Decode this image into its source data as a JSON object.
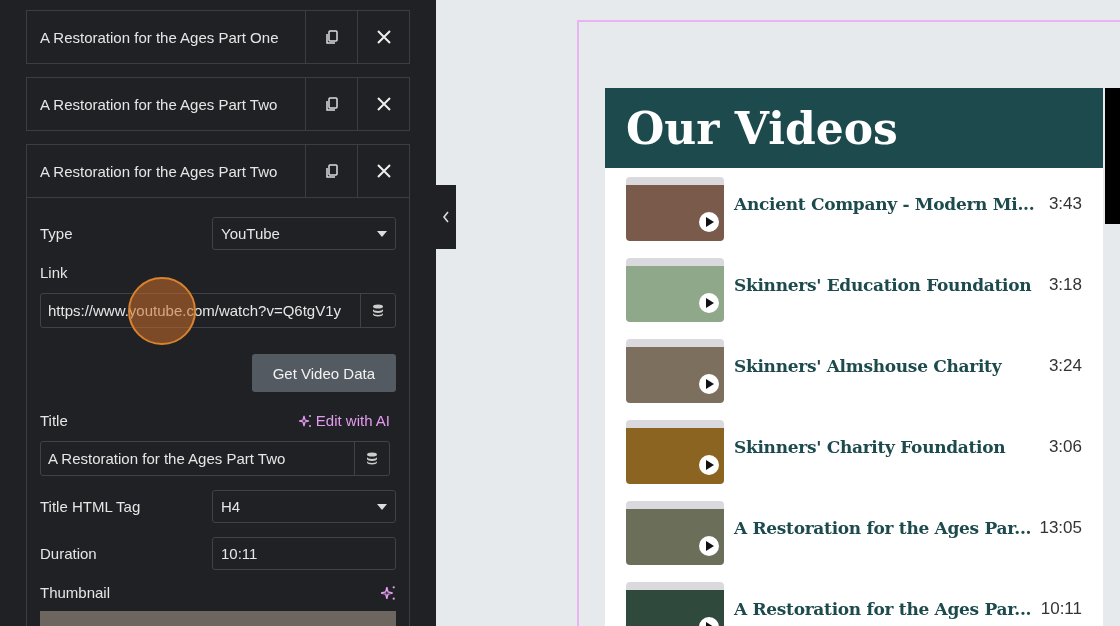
{
  "editor": {
    "items": [
      {
        "title": "A Restoration for the Ages Part One",
        "expanded": false
      },
      {
        "title": "A Restoration for the Ages Part Two",
        "expanded": false
      },
      {
        "title": "A Restoration for the Ages Part Two",
        "expanded": true
      }
    ],
    "fields": [
      {
        "kind": "select",
        "label": "Type",
        "value": "YouTube"
      },
      {
        "kind": "dynamic",
        "label": "Link",
        "value": "https://www.youtube.com/watch?v=Q6tgV1y"
      },
      {
        "kind": "button",
        "label": "Get Video Data"
      },
      {
        "kind": "dynamic",
        "label": "Title",
        "action": "Edit with AI",
        "value": "A Restoration for the Ages Part Two"
      },
      {
        "kind": "select",
        "label": "Title HTML Tag",
        "value": "H4"
      },
      {
        "kind": "text",
        "label": "Duration",
        "value": "10:11"
      },
      {
        "kind": "image",
        "label": "Thumbnail"
      }
    ]
  },
  "preview": {
    "heading": "Our Videos",
    "videos": [
      {
        "title": "Ancient Company - Modern Mi...",
        "duration": "3:43"
      },
      {
        "title": "Skinners' Education Foundation",
        "duration": "3:18"
      },
      {
        "title": "Skinners' Almshouse Charity",
        "duration": "3:24"
      },
      {
        "title": "Skinners' Charity Foundation",
        "duration": "3:06"
      },
      {
        "title": "A Restoration for the Ages Par...",
        "duration": "13:05"
      },
      {
        "title": "A Restoration for the Ages Par...",
        "duration": "10:11"
      }
    ]
  }
}
